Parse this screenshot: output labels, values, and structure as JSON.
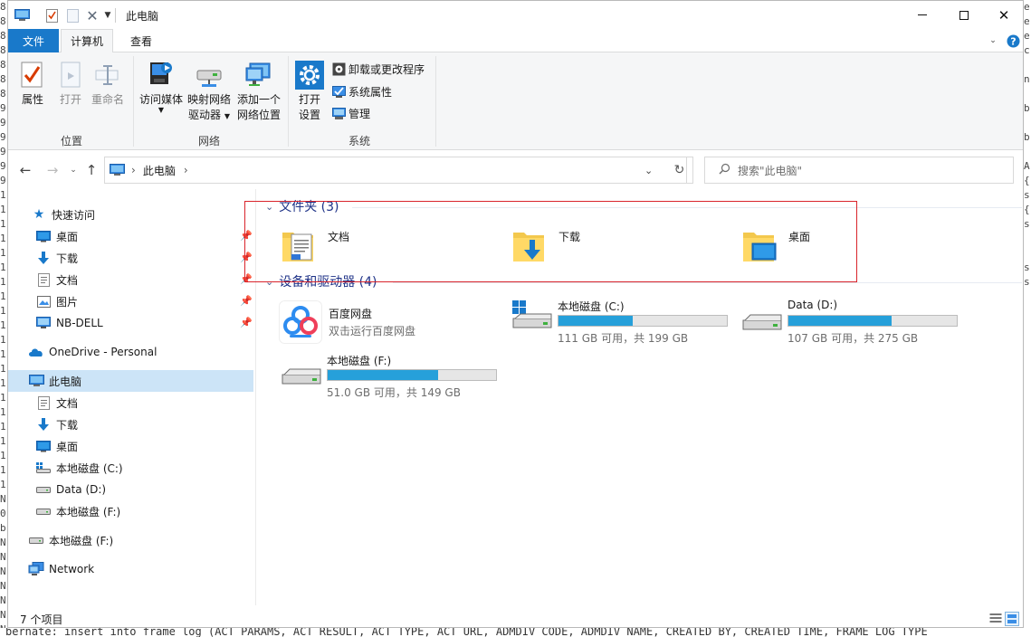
{
  "background": {
    "left_chars": [
      "8",
      "8",
      "8",
      "8",
      "8",
      "8",
      "8",
      "9",
      "9",
      "9",
      "9",
      "9",
      "9",
      "1",
      "1",
      "1",
      "1",
      "1",
      "1",
      "1",
      "1",
      "1",
      "1",
      "1",
      "1",
      "1",
      "1",
      "1",
      "1",
      "1",
      "1",
      "1",
      "1",
      "1",
      "N",
      "0",
      "b",
      "N",
      "N",
      "N",
      "N",
      "N",
      "N",
      "N"
    ],
    "right_chars": [
      "e",
      "e",
      "e",
      "c",
      "",
      "n",
      "",
      "b",
      "",
      "b",
      "",
      "A",
      "{",
      "s",
      "{",
      "s",
      "",
      "",
      "s",
      "s",
      "",
      "",
      "",
      "",
      "",
      "",
      "",
      "",
      "",
      "",
      "",
      "",
      "",
      "",
      ""
    ],
    "bottom_text": "bernate: insert into frame_log (ACT_PARAMS, ACT_RESULT, ACT_TYPE, ACT_URL, ADMDIV_CODE, ADMDIV_NAME, CREATED_BY, CREATED_TIME, FRAME_LOG_TYPE"
  },
  "window": {
    "title": "此电脑",
    "quick_access": [
      "computer-icon",
      "properties-icon",
      "new-folder-icon",
      "delete-icon",
      "customize-chevron-icon"
    ]
  },
  "tabs": {
    "file": "文件",
    "computer": "计算机",
    "view": "查看"
  },
  "ribbon": {
    "groups": {
      "location": "位置",
      "network": "网络",
      "system": "系统"
    },
    "buttons": {
      "properties": "属性",
      "open": "打开",
      "rename": "重命名",
      "access_media": "访问媒体",
      "map_drive_line1": "映射网络",
      "map_drive_line2": "驱动器",
      "add_location_line1": "添加一个",
      "add_location_line2": "网络位置",
      "open_settings_line1": "打开",
      "open_settings_line2": "设置",
      "uninstall": "卸载或更改程序",
      "system_properties": "系统属性",
      "manage": "管理"
    }
  },
  "address": {
    "path": "此电脑",
    "separator": "›",
    "search_placeholder": "搜索\"此电脑\""
  },
  "nav_pane": {
    "quick_access": "快速访问",
    "quick_items": [
      {
        "label": "桌面",
        "icon": "desktop-icon"
      },
      {
        "label": "下载",
        "icon": "download-icon"
      },
      {
        "label": "文档",
        "icon": "document-icon"
      },
      {
        "label": "图片",
        "icon": "picture-icon"
      },
      {
        "label": "NB-DELL",
        "icon": "monitor-icon"
      }
    ],
    "onedrive": "OneDrive - Personal",
    "this_pc": "此电脑",
    "pc_items": [
      {
        "label": "文档",
        "icon": "document-icon"
      },
      {
        "label": "下载",
        "icon": "download-icon"
      },
      {
        "label": "桌面",
        "icon": "desktop-icon"
      },
      {
        "label": "本地磁盘 (C:)",
        "icon": "windows-drive-icon"
      },
      {
        "label": "Data (D:)",
        "icon": "drive-icon"
      },
      {
        "label": "本地磁盘 (F:)",
        "icon": "drive-icon"
      }
    ],
    "external_drive": "本地磁盘 (F:)",
    "network": "Network"
  },
  "content": {
    "folders_header": "文件夹 (3)",
    "folders": [
      {
        "name": "文档",
        "icon": "documents-folder-icon"
      },
      {
        "name": "下载",
        "icon": "downloads-folder-icon"
      },
      {
        "name": "桌面",
        "icon": "desktop-folder-icon"
      }
    ],
    "devices_header": "设备和驱动器 (4)",
    "app": {
      "name": "百度网盘",
      "subtitle": "双击运行百度网盘"
    },
    "drives": [
      {
        "name": "本地磁盘 (C:)",
        "free": "111 GB 可用，共 199 GB",
        "used_fraction": 0.442
      },
      {
        "name": "Data (D:)",
        "free": "107 GB 可用，共 275 GB",
        "used_fraction": 0.611
      },
      {
        "name": "本地磁盘 (F:)",
        "free": "51.0 GB 可用，共 149 GB",
        "used_fraction": 0.658
      }
    ]
  },
  "status": {
    "count": "7 个项目"
  },
  "colors": {
    "accent": "#1979ca",
    "selection": "#cce4f7",
    "drive_fill": "#26a0da",
    "section_title": "#1e3287",
    "annotation": "#d9242b"
  }
}
